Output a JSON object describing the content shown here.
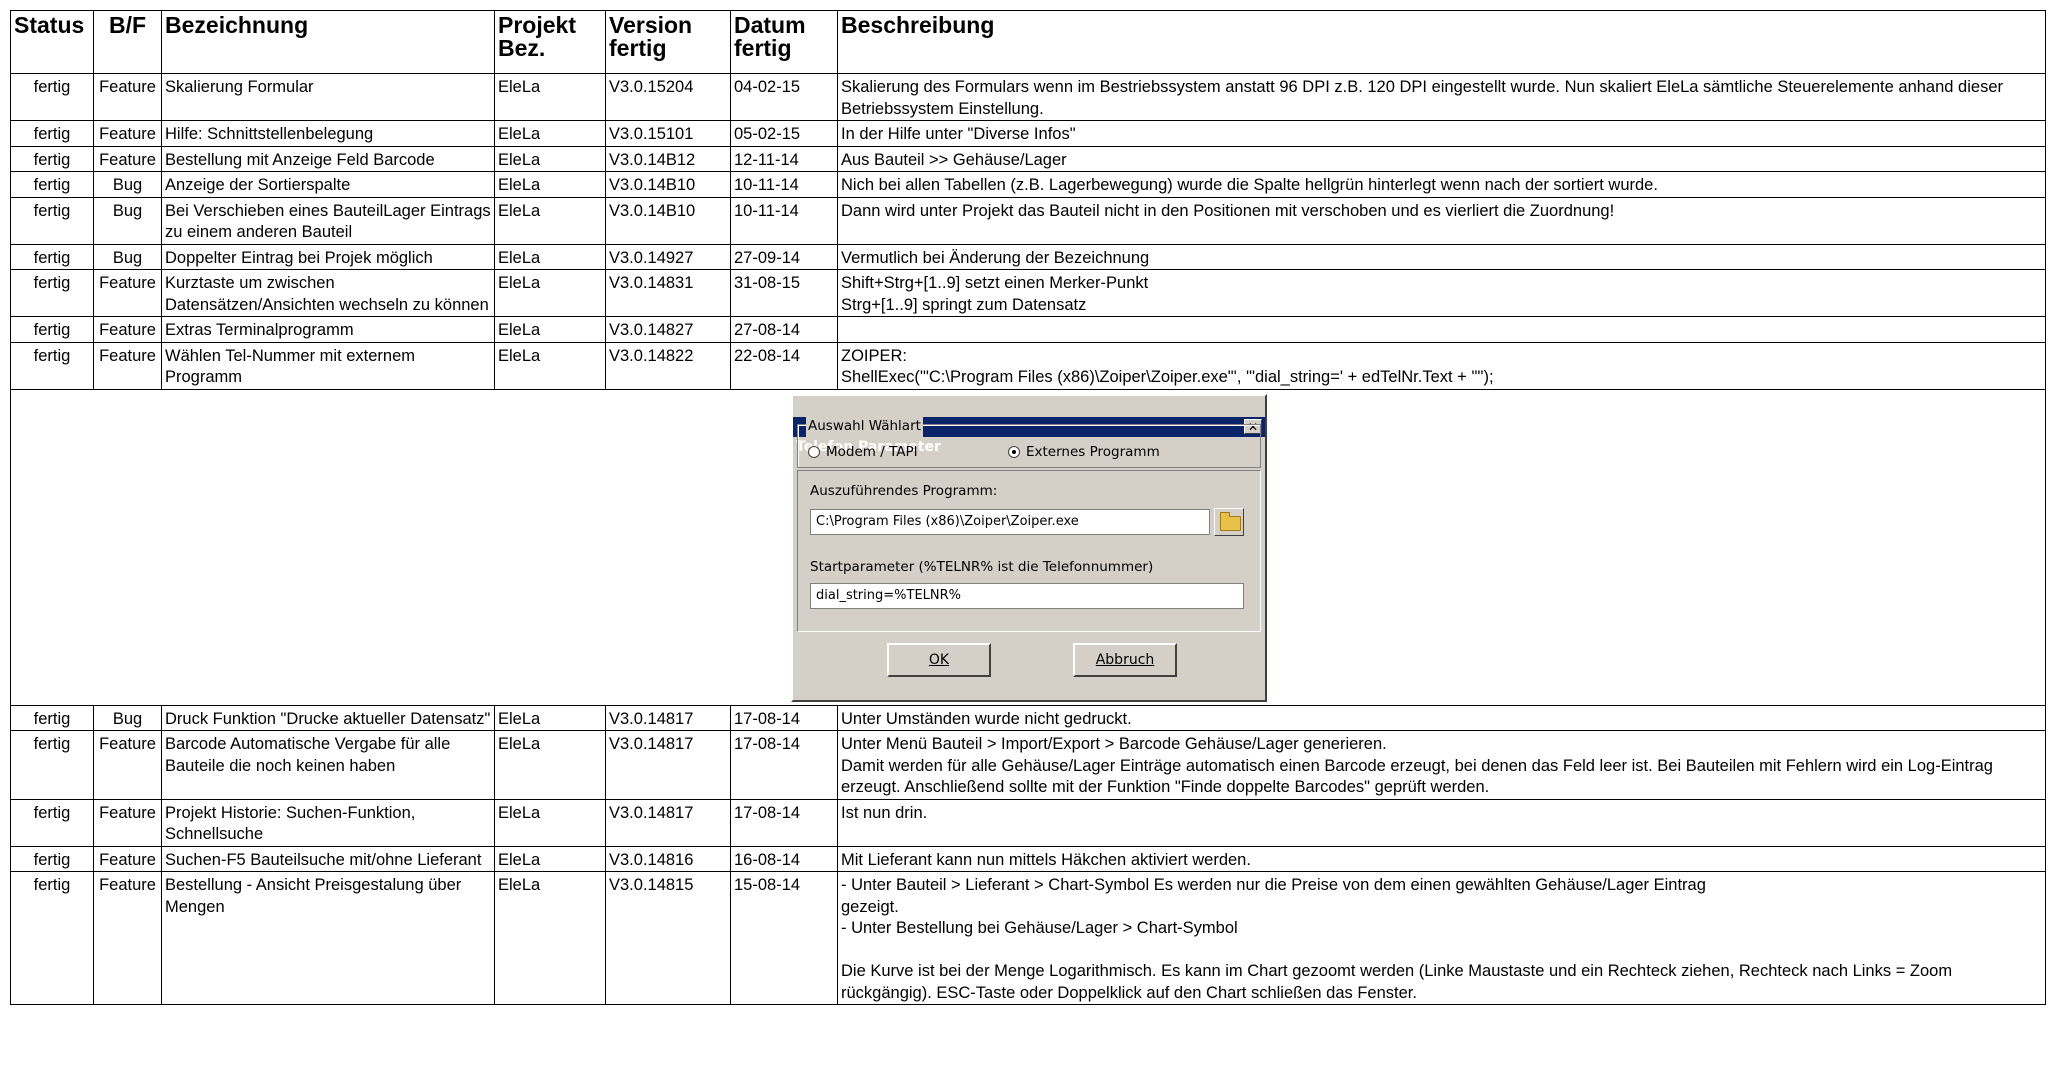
{
  "headers": [
    "Status",
    "B/F",
    "Bezeichnung",
    "Projekt\nBez.",
    "Version\nfertig",
    "Datum\nfertig",
    "Beschreibung"
  ],
  "rows_top": [
    {
      "status": "fertig",
      "bf": "Feature",
      "bez": "Skalierung Formular",
      "projekt": "EleLa",
      "version": "V3.0.15204",
      "datum": "04-02-15",
      "beschreibung": "Skalierung des Formulars wenn im Bestriebssystem anstatt 96 DPI z.B. 120 DPI eingestellt wurde. Nun skaliert EleLa sämtliche Steuerelemente anhand dieser Betriebssystem Einstellung."
    },
    {
      "status": "fertig",
      "bf": "Feature",
      "bez": "Hilfe: Schnittstellenbelegung",
      "projekt": "EleLa",
      "version": "V3.0.15101",
      "datum": "05-02-15",
      "beschreibung": "In der Hilfe unter \"Diverse Infos\""
    },
    {
      "status": "fertig",
      "bf": "Feature",
      "bez": "Bestellung mit Anzeige Feld Barcode",
      "projekt": "EleLa",
      "version": "V3.0.14B12",
      "datum": "12-11-14",
      "beschreibung": "Aus Bauteil >> Gehäuse/Lager"
    },
    {
      "status": "fertig",
      "bf": "Bug",
      "bez": "Anzeige der Sortierspalte",
      "projekt": "EleLa",
      "version": "V3.0.14B10",
      "datum": "10-11-14",
      "beschreibung": "Nich bei allen Tabellen (z.B. Lagerbewegung) wurde die Spalte hellgrün hinterlegt wenn nach der sortiert wurde."
    },
    {
      "status": "fertig",
      "bf": "Bug",
      "bez": "Bei Verschieben eines BauteilLager Eintrags zu einem anderen Bauteil",
      "projekt": "EleLa",
      "version": "V3.0.14B10",
      "datum": "10-11-14",
      "beschreibung": "Dann wird unter Projekt das Bauteil nicht in den Positionen mit verschoben und es vierliert die Zuordnung!"
    },
    {
      "status": "fertig",
      "bf": "Bug",
      "bez": "Doppelter Eintrag bei Projek möglich",
      "projekt": "EleLa",
      "version": "V3.0.14927",
      "datum": "27-09-14",
      "beschreibung": "Vermutlich bei Änderung der Bezeichnung"
    },
    {
      "status": "fertig",
      "bf": "Feature",
      "bez": "Kurztaste um zwischen Datensätzen/Ansichten wechseln zu können",
      "projekt": "EleLa",
      "version": "V3.0.14831",
      "datum": "31-08-15",
      "beschreibung": "Shift+Strg+[1..9] setzt einen Merker-Punkt\nStrg+[1..9] springt zum Datensatz"
    },
    {
      "status": "fertig",
      "bf": "Feature",
      "bez": "Extras Terminalprogramm",
      "projekt": "EleLa",
      "version": "V3.0.14827",
      "datum": "27-08-14",
      "beschreibung": ""
    },
    {
      "status": "fertig",
      "bf": "Feature",
      "bez": "Wählen Tel-Nummer mit externem Programm",
      "projekt": "EleLa",
      "version": "V3.0.14822",
      "datum": "22-08-14",
      "beschreibung": "ZOIPER:\nShellExec('\"C:\\Program Files (x86)\\Zoiper\\Zoiper.exe\"', '\"dial_string=' + edTelNr.Text + '\"');"
    }
  ],
  "dialog": {
    "title": "Telefon Parameter",
    "close": "✕",
    "group_label": "Auswahl Wählart",
    "radio_modem": "Modem / TAPI",
    "radio_extern": "Externes Programm",
    "program_label": "Auszuführendes Programm:",
    "program_value": "C:\\Program Files (x86)\\Zoiper\\Zoiper.exe",
    "param_label": "Startparameter (%TELNR% ist die Telefonnummer)",
    "param_value": "dial_string=%TELNR%",
    "ok": "OK",
    "cancel": "Abbruch"
  },
  "rows_bottom": [
    {
      "status": "fertig",
      "bf": "Bug",
      "bez": "Druck Funktion \"Drucke aktueller Datensatz\"",
      "projekt": "EleLa",
      "version": "V3.0.14817",
      "datum": "17-08-14",
      "beschreibung": "Unter Umständen wurde nicht gedruckt."
    },
    {
      "status": "fertig",
      "bf": "Feature",
      "bez": "Barcode Automatische Vergabe für alle Bauteile die noch keinen haben",
      "projekt": "EleLa",
      "version": "V3.0.14817",
      "datum": "17-08-14",
      "beschreibung": "Unter Menü Bauteil > Import/Export > Barcode Gehäuse/Lager generieren.\nDamit werden für alle Gehäuse/Lager Einträge automatisch einen Barcode erzeugt, bei denen das Feld leer ist. Bei Bauteilen mit Fehlern wird ein Log-Eintrag erzeugt. Anschließend sollte mit der Funktion \"Finde doppelte Barcodes\" geprüft werden."
    },
    {
      "status": "fertig",
      "bf": "Feature",
      "bez": "Projekt Historie: Suchen-Funktion, Schnellsuche",
      "projekt": "EleLa",
      "version": "V3.0.14817",
      "datum": "17-08-14",
      "beschreibung": "Ist nun drin."
    },
    {
      "status": "fertig",
      "bf": "Feature",
      "bez": "Suchen-F5 Bauteilsuche mit/ohne Lieferant",
      "projekt": "EleLa",
      "version": "V3.0.14816",
      "datum": "16-08-14",
      "beschreibung": "Mit Lieferant kann nun mittels Häkchen aktiviert werden."
    },
    {
      "status": "fertig",
      "bf": "Feature",
      "bez": "Bestellung - Ansicht Preisgestalung über Mengen",
      "projekt": "EleLa",
      "version": "V3.0.14815",
      "datum": "15-08-14",
      "beschreibung": "- Unter Bauteil > Lieferant > Chart-Symbol Es werden nur die Preise von dem einen gewählten Gehäuse/Lager Eintrag\ngezeigt.\n- Unter Bestellung bei Gehäuse/Lager > Chart-Symbol\n\nDie Kurve ist bei der Menge Logarithmisch. Es kann im Chart gezoomt werden (Linke Maustaste und ein Rechteck ziehen, Rechteck nach Links = Zoom rückgängig). ESC-Taste oder Doppelklick auf den Chart schließen das Fenster."
    }
  ]
}
